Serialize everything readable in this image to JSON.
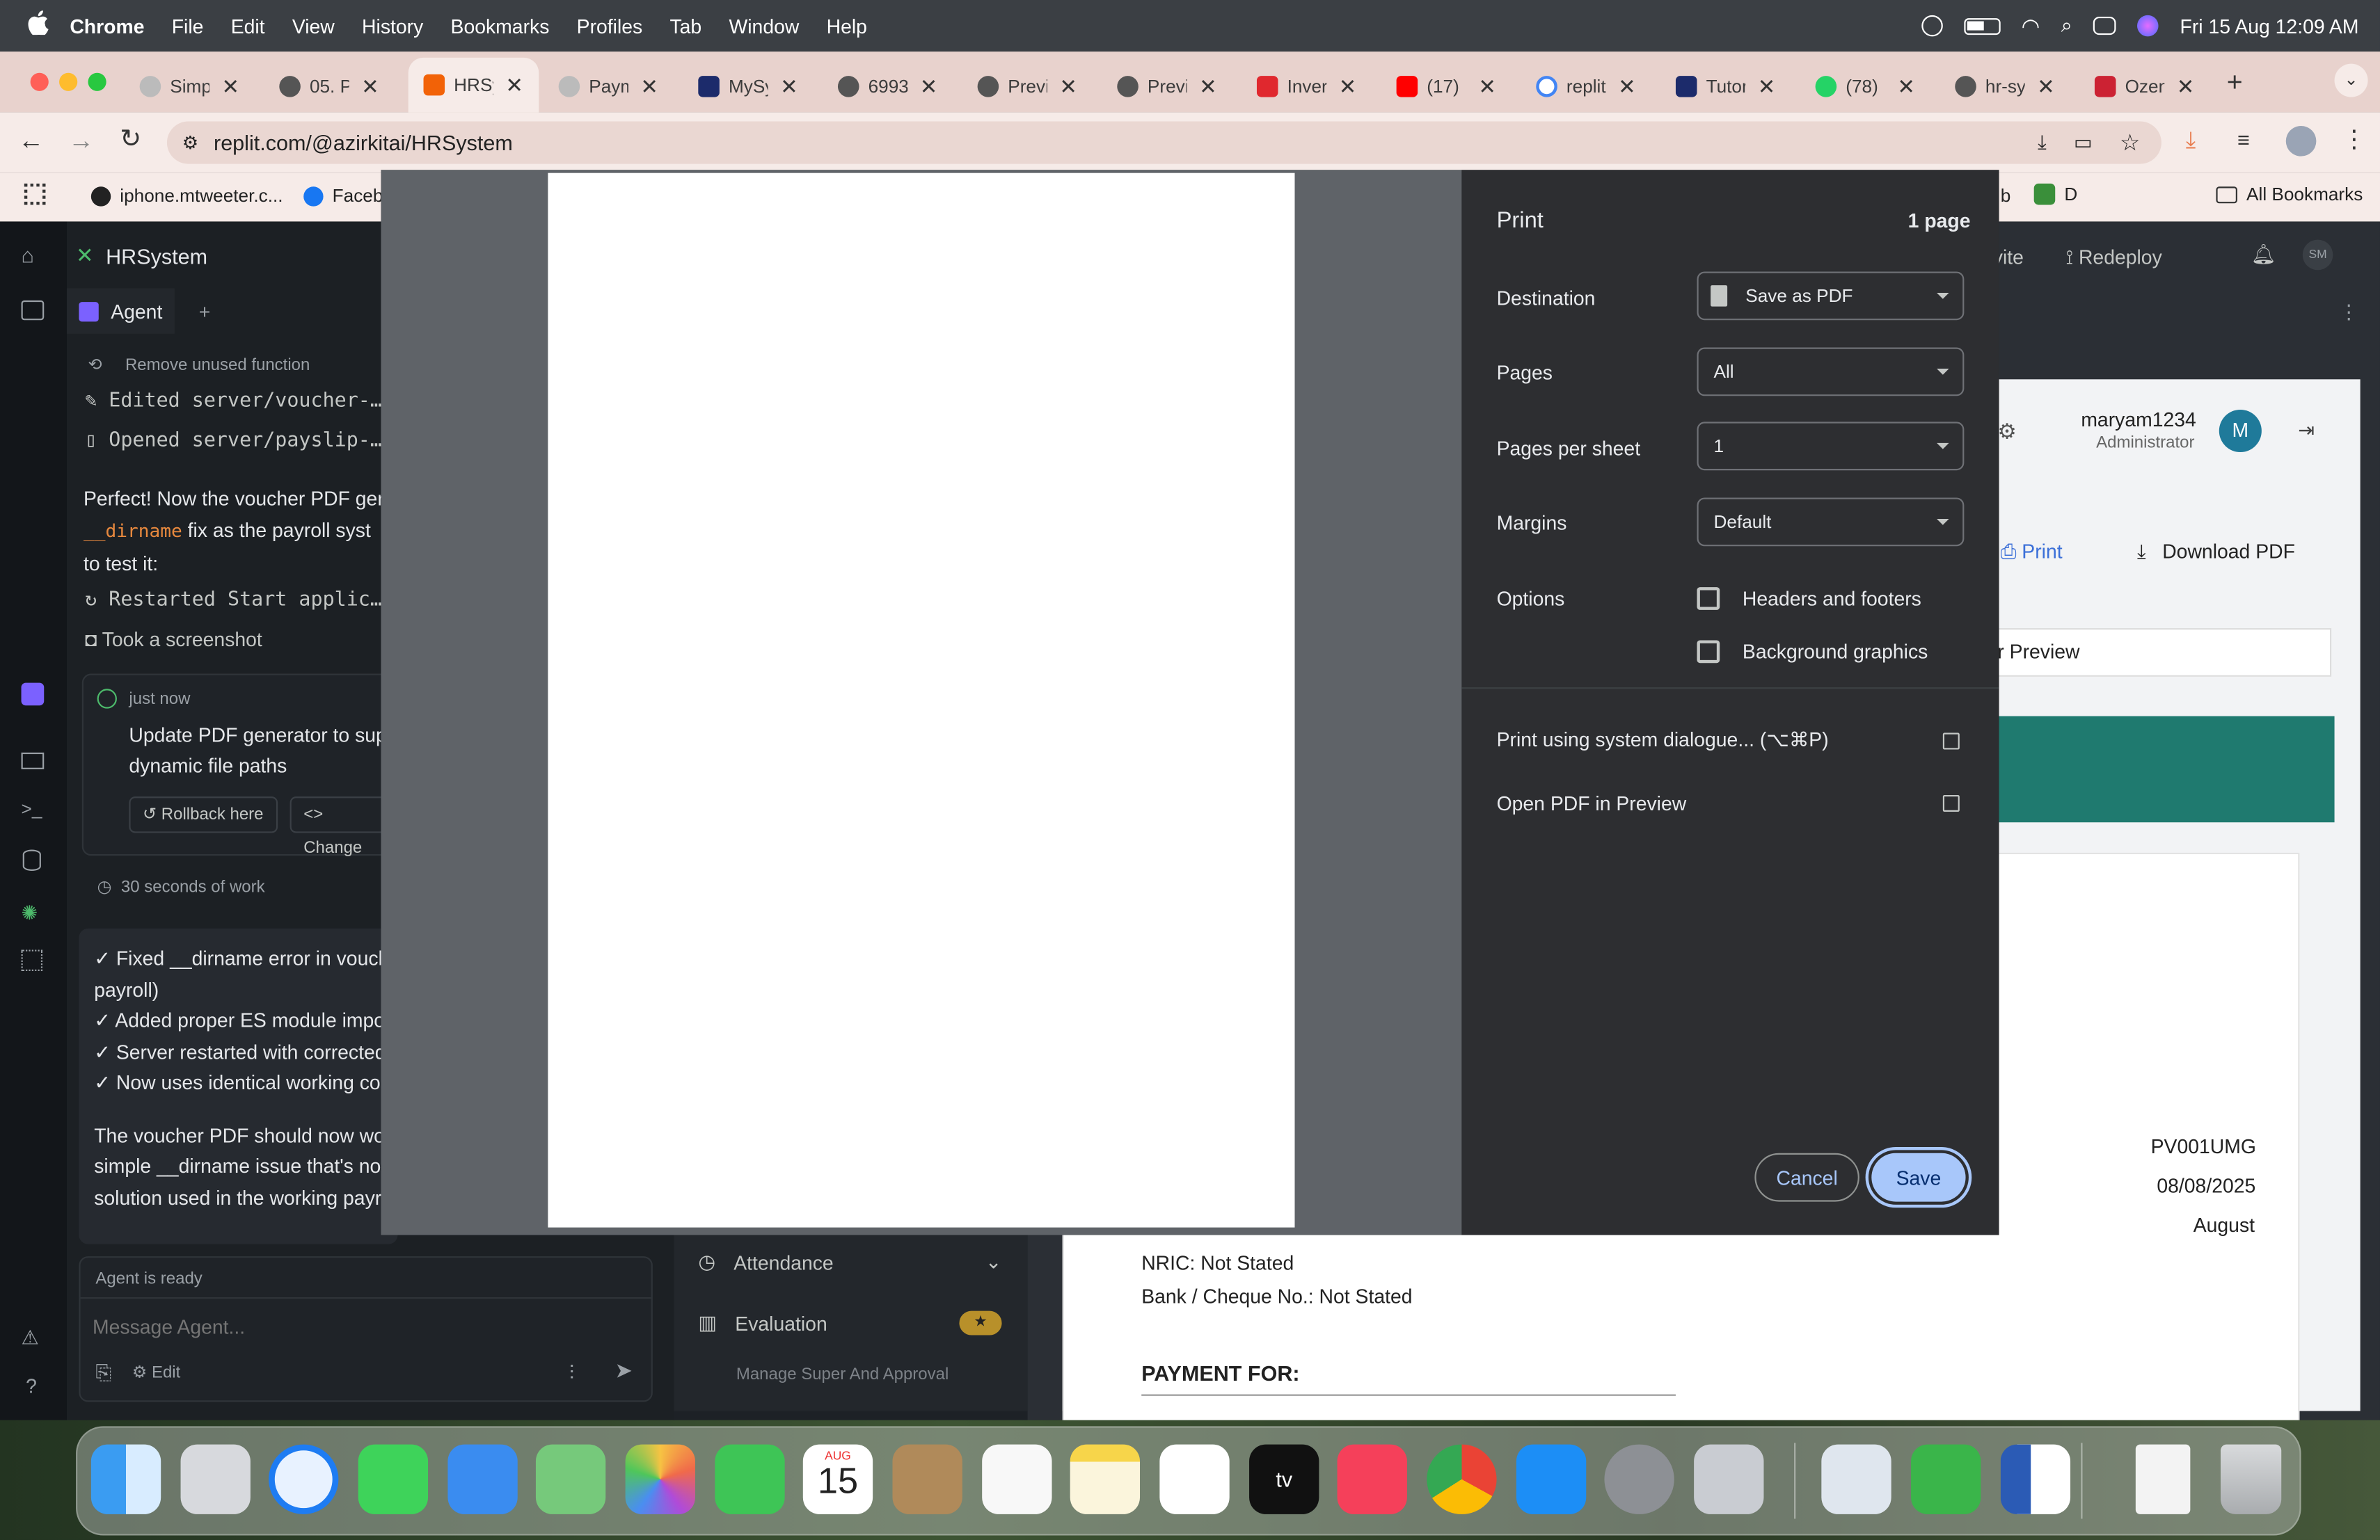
{
  "menubar": {
    "app_name": "Chrome",
    "items": [
      "File",
      "Edit",
      "View",
      "History",
      "Bookmarks",
      "Profiles",
      "Tab",
      "Window",
      "Help"
    ],
    "datetime": "Fri 15 Aug  12:09 AM"
  },
  "tabs": [
    {
      "title": "Simp"
    },
    {
      "title": "05. P"
    },
    {
      "title": "HRSy"
    },
    {
      "title": "Paym"
    },
    {
      "title": "MySy"
    },
    {
      "title": "6993"
    },
    {
      "title": "Previ"
    },
    {
      "title": "Previ"
    },
    {
      "title": "Inver"
    },
    {
      "title": "(17) "
    },
    {
      "title": "replit"
    },
    {
      "title": "Tutor"
    },
    {
      "title": "(78)"
    },
    {
      "title": "hr-sy"
    },
    {
      "title": "Ozen"
    }
  ],
  "address": {
    "url": "replit.com/@azirkitai/HRSystem"
  },
  "bookmarks": {
    "item1": "iphone.mtweeter.c...",
    "item2": "Faceb",
    "item3": "b",
    "item4": "D",
    "all": "All Bookmarks"
  },
  "replit": {
    "project_name": "HRSystem",
    "agent_tab": "Agent",
    "history": [
      {
        "text": "Remove unused function"
      },
      {
        "text": "Edited server/voucher-pdf-"
      },
      {
        "text": "Opened server/payslip-htm"
      }
    ],
    "message_parts": {
      "a": "Perfect! Now the voucher PDF gen",
      "code": "__dirname",
      "b": " fix as the payroll syst",
      "c": "to test it:"
    },
    "restarted": "Restarted Start applicatio",
    "screenshot": "Took a screenshot",
    "checkpoint": {
      "time": "just now",
      "title_line1": "Update PDF generator to sup",
      "title_line2": "dynamic file paths",
      "rollback": "Rollback here",
      "changes": "Change"
    },
    "work": "30 seconds of work",
    "summary_lines": [
      "✓ Fixed __dirname error in vouch",
      "payroll)",
      "✓ Added proper ES module impo",
      "✓ Server restarted with corrected",
      "✓ Now uses identical working co"
    ],
    "summary_para": [
      "The voucher PDF should now wo",
      "simple __dirname issue that's no",
      "solution used in the working payr"
    ],
    "status": "Agent is ready",
    "input_placeholder": "Message Agent...",
    "edit_label": "Edit",
    "topbar_invite": "vite",
    "topbar_redeploy": "Redeploy",
    "avatar_initials": "SM"
  },
  "app": {
    "user_name": "maryam1234",
    "user_role": "Administrator",
    "user_initial": "M",
    "print_label": "Print",
    "download_label": "Download PDF",
    "preview_tab": "r Preview",
    "voucher_no": "PV001UMG",
    "voucher_date": "08/08/2025",
    "voucher_month": "August",
    "nric": "NRIC: Not Stated",
    "bank": "Bank / Cheque No.: Not Stated",
    "payment_for": "PAYMENT FOR:",
    "nav_attendance": "Attendance",
    "nav_evaluation": "Evaluation",
    "nav_manage": "Manage Super And Approval"
  },
  "print_dialog": {
    "title": "Print",
    "page_count": "1 page",
    "destination_label": "Destination",
    "destination_value": "Save as PDF",
    "pages_label": "Pages",
    "pages_value": "All",
    "pps_label": "Pages per sheet",
    "pps_value": "1",
    "margins_label": "Margins",
    "margins_value": "Default",
    "options_label": "Options",
    "opt_headers": "Headers and footers",
    "opt_headers_checked": false,
    "opt_background": "Background graphics",
    "opt_background_checked": false,
    "system_dialog": "Print using system dialogue... (⌥⌘P)",
    "open_preview": "Open PDF in Preview",
    "cancel": "Cancel",
    "save": "Save"
  },
  "dock": {
    "calendar_month": "AUG",
    "calendar_day": "15"
  },
  "colors": {
    "dialog_bg": "#202124",
    "settings_bg": "#2d2e31",
    "save_button": "#a8c7fa",
    "teal_banner": "#1f7a6f",
    "tab_strip": "#e8d2cd"
  }
}
